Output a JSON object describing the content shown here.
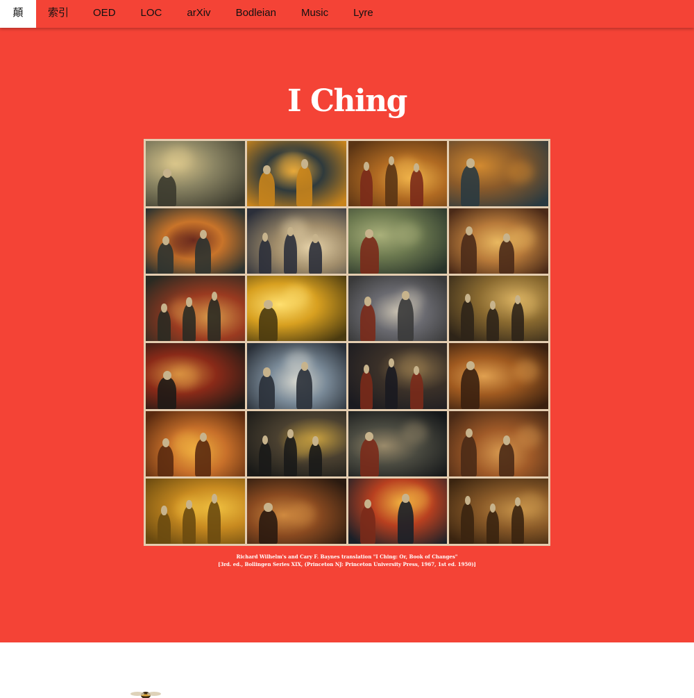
{
  "nav": {
    "items": [
      {
        "label": "顛",
        "active": true
      },
      {
        "label": "索引"
      },
      {
        "label": "OED"
      },
      {
        "label": "LOC"
      },
      {
        "label": "arXiv"
      },
      {
        "label": "Bodleian"
      },
      {
        "label": "Music"
      },
      {
        "label": "Lyre"
      }
    ]
  },
  "page": {
    "title": "I Ching",
    "caption_line1": "Richard Wilhelm's and Cary F. Baynes translation \"I Ching: Or, Book of Changes\"",
    "caption_line2": "[3rd. ed., Bollingen Series XIX, (Princeton NJ: Princeton University Press, 1967, 1st ed. 1950)]"
  },
  "colors": {
    "accent": "#f44336",
    "frame": "#e4cdb0"
  },
  "footer": {
    "logo_icon": "bee-icon"
  }
}
